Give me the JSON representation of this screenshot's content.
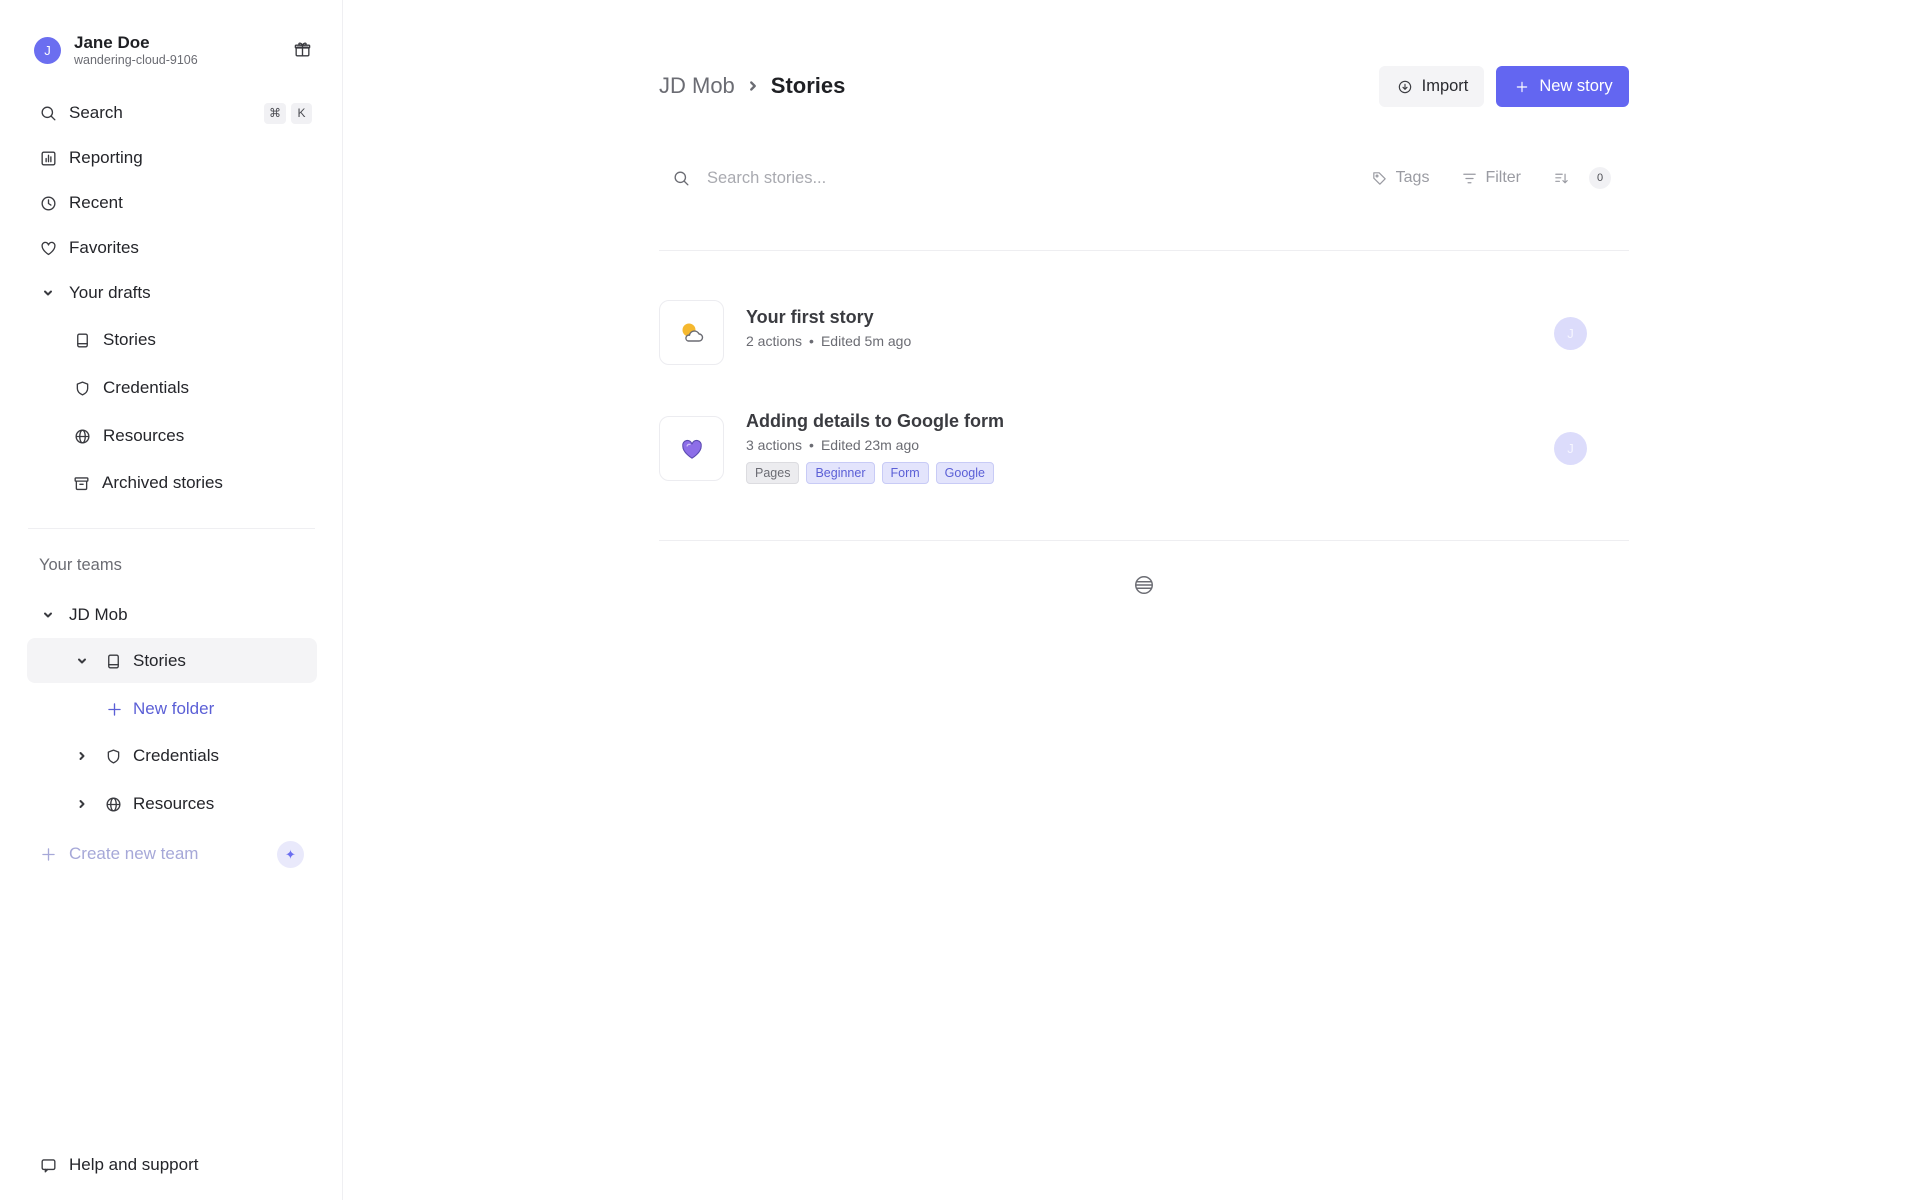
{
  "user": {
    "avatar_letter": "J",
    "name": "Jane Doe",
    "workspace": "wandering-cloud-9106"
  },
  "nav": {
    "search": {
      "label": "Search",
      "shortcut": [
        "⌘",
        "K"
      ]
    },
    "reporting": "Reporting",
    "recent": "Recent",
    "favorites": "Favorites",
    "drafts": {
      "label": "Your drafts",
      "items": [
        "Stories",
        "Credentials",
        "Resources",
        "Archived stories"
      ]
    }
  },
  "teams": {
    "section_label": "Your teams",
    "team_name": "JD Mob",
    "stories": "Stories",
    "new_folder": "New folder",
    "credentials": "Credentials",
    "resources": "Resources",
    "create_team": "Create new team"
  },
  "help": "Help and support",
  "header": {
    "breadcrumb_team": "JD Mob",
    "breadcrumb_page": "Stories",
    "import_label": "Import",
    "new_story_label": "New story"
  },
  "search": {
    "placeholder": "Search stories...",
    "tags_label": "Tags",
    "filter_label": "Filter",
    "count": "0"
  },
  "stories": [
    {
      "title": "Your first story",
      "actions": "2 actions",
      "edited": "Edited 5m ago",
      "icon": "sun-cloud-icon",
      "owner_initial": "J",
      "tags": []
    },
    {
      "title": "Adding details to Google form",
      "actions": "3 actions",
      "edited": "Edited 23m ago",
      "icon": "heart-icon",
      "owner_initial": "J",
      "tags": [
        "Pages",
        "Beginner",
        "Form",
        "Google"
      ]
    }
  ],
  "colors": {
    "accent": "#6366f1",
    "sidebar_active": "#f4f4f6",
    "tag_blue_bg": "#e3e4fc",
    "tag_blue_text": "#5b5fd6"
  }
}
